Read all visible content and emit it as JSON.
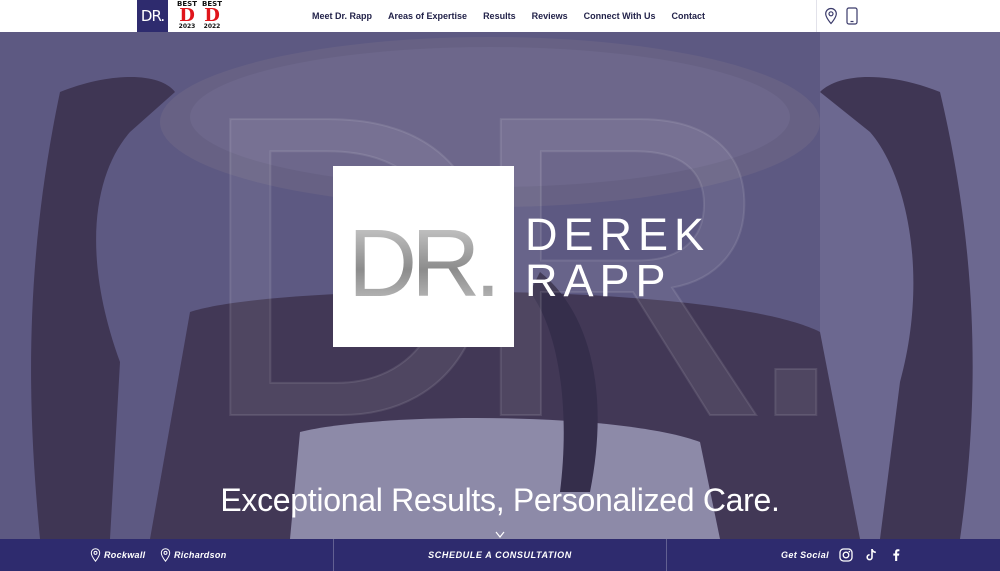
{
  "header": {
    "logo_text": "DR.",
    "awards": [
      {
        "label": "BEST",
        "mark": "D",
        "year": "2023"
      },
      {
        "label": "BEST",
        "mark": "D",
        "year": "2022"
      }
    ],
    "nav": [
      "Meet Dr. Rapp",
      "Areas of Expertise",
      "Results",
      "Reviews",
      "Connect With Us",
      "Contact"
    ],
    "icons": [
      "location-pin-icon",
      "phone-icon"
    ]
  },
  "hero": {
    "watermark": "DR.",
    "logo_mark": "DR.",
    "brand_line1": "DEREK",
    "brand_line2": "RAPP",
    "tagline": "Exceptional Results, Personalized Care.",
    "overlay_color": "#4a4678"
  },
  "bottom_bar": {
    "locations": [
      "Rockwall",
      "Richardson"
    ],
    "cta": "SCHEDULE A CONSULTATION",
    "social_label": "Get Social",
    "social_icons": [
      "instagram-icon",
      "tiktok-icon",
      "facebook-icon"
    ],
    "background": "#2e2b6e"
  }
}
